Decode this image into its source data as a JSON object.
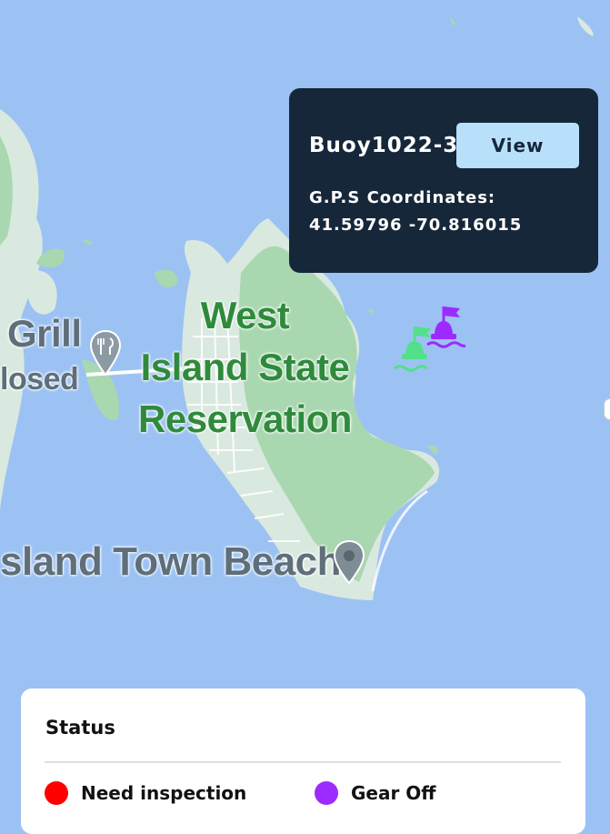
{
  "map": {
    "park_label_lines": [
      "West",
      "Island State",
      "Reservation"
    ],
    "restaurant_label": "Grill",
    "restaurant_status": "losed",
    "beach_label": "sland Town Beach"
  },
  "colors": {
    "water": "#9cc2f4",
    "land": "#d9e9df",
    "park": "#a9d7b0",
    "popup_bg": "#16273a",
    "view_button_bg": "#b9e0fb",
    "gear_off": "#9c2bff",
    "need_inspection": "#ff0000",
    "buoy_green": "#53e08b"
  },
  "icons": {
    "restaurant": "fork-knife-icon",
    "beach": "map-pin-icon",
    "buoys": [
      "buoy-marker-icon",
      "buoy-marker-icon"
    ]
  },
  "popup": {
    "title": "Buoy1022-3",
    "view_label": "View",
    "coordinates_label": "G.P.S Coordinates:",
    "coordinates_value": "41.59796 -70.816015"
  },
  "status": {
    "title": "Status",
    "legend": [
      {
        "label": "Need inspection",
        "color": "#ff0000"
      },
      {
        "label": "Gear Off",
        "color": "#9c2bff"
      }
    ]
  }
}
